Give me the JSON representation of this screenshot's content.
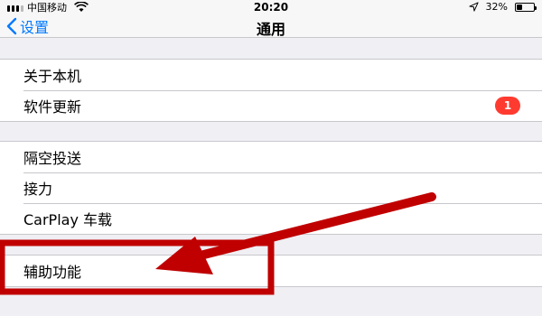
{
  "status_bar": {
    "carrier": "中国移动",
    "time": "20:20",
    "battery": "32%",
    "battery_level": 0.32,
    "icons": [
      "signal-icon",
      "wifi-icon",
      "location-icon",
      "battery-icon"
    ]
  },
  "nav": {
    "back_label": "设置",
    "title": "通用"
  },
  "groups": [
    {
      "rows": [
        {
          "label": "关于本机"
        },
        {
          "label": "软件更新",
          "badge": "1"
        }
      ]
    },
    {
      "rows": [
        {
          "label": "隔空投送"
        },
        {
          "label": "接力"
        },
        {
          "label": "CarPlay 车载"
        }
      ]
    },
    {
      "rows": [
        {
          "label": "辅助功能"
        }
      ]
    }
  ],
  "colors": {
    "accent": "#007aff",
    "badge": "#ff3b30",
    "annotation": "#c00000",
    "background": "#efeff4"
  }
}
